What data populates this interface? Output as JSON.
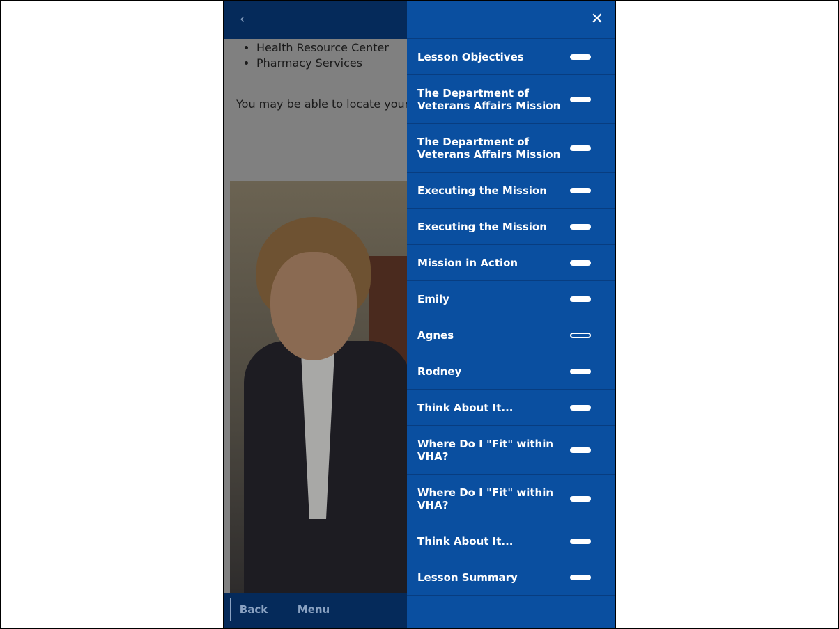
{
  "nav": {
    "back_chevron": "‹"
  },
  "content": {
    "bullets": [
      "Health Resource Center",
      "Pharmacy Services"
    ],
    "paragraph": "You may be able to locate your VISN"
  },
  "footer": {
    "back_label": "Back",
    "menu_label": "Menu"
  },
  "menu": {
    "close_glyph": "✕",
    "items": [
      {
        "label": "Lesson Objectives",
        "status": "complete"
      },
      {
        "label": "The Department of Veterans Affairs Mission",
        "status": "complete"
      },
      {
        "label": "The Department of Veterans Affairs Mission",
        "status": "complete"
      },
      {
        "label": "Executing the Mission",
        "status": "complete"
      },
      {
        "label": "Executing the Mission",
        "status": "complete"
      },
      {
        "label": "Mission in Action",
        "status": "complete"
      },
      {
        "label": "Emily",
        "status": "complete"
      },
      {
        "label": "Agnes",
        "status": "incomplete"
      },
      {
        "label": "Rodney",
        "status": "complete"
      },
      {
        "label": "Think About It...",
        "status": "complete"
      },
      {
        "label": "Where Do I \"Fit\" within VHA?",
        "status": "complete"
      },
      {
        "label": "Where Do I \"Fit\" within VHA?",
        "status": "complete"
      },
      {
        "label": "Think About It...",
        "status": "complete"
      },
      {
        "label": "Lesson Summary",
        "status": "complete"
      }
    ]
  },
  "colors": {
    "accent": "#0a4fa0",
    "bar": "#052a5a"
  }
}
